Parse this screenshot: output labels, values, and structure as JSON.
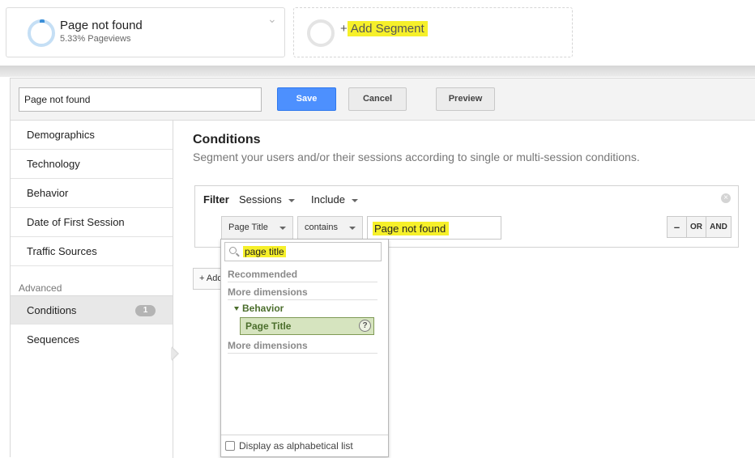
{
  "segments": {
    "active": {
      "title": "Page not found",
      "subtitle": "5.33% Pageviews"
    },
    "add": {
      "plus": "+",
      "label": "Add Segment"
    }
  },
  "editor": {
    "segment_name": "Page not found",
    "buttons": {
      "save": "Save",
      "cancel": "Cancel",
      "preview": "Preview"
    }
  },
  "sidebar": {
    "items": [
      {
        "label": "Demographics"
      },
      {
        "label": "Technology"
      },
      {
        "label": "Behavior"
      },
      {
        "label": "Date of First Session"
      },
      {
        "label": "Traffic Sources"
      }
    ],
    "advanced_label": "Advanced",
    "advanced_items": [
      {
        "label": "Conditions",
        "badge": "1",
        "active": true
      },
      {
        "label": "Sequences"
      }
    ]
  },
  "conditions": {
    "title": "Conditions",
    "description": "Segment your users and/or their sessions according to single or multi-session conditions.",
    "filter": {
      "label": "Filter",
      "scope": "Sessions",
      "mode": "Include",
      "dimension": "Page Title",
      "operator": "contains",
      "value": "Page not found",
      "buttons": {
        "minus": "–",
        "or": "OR",
        "and": "AND"
      }
    },
    "add_button": "+ Add"
  },
  "dimension_picker": {
    "search_value": "page title",
    "groups": {
      "recommended": "Recommended",
      "more_dimensions": "More dimensions",
      "category": "Behavior",
      "option": "Page Title",
      "more_dimensions_2": "More dimensions"
    },
    "help_glyph": "?",
    "footer_label": "Display as alphabetical list"
  },
  "colors": {
    "highlight": "#f6f02a",
    "primary_button": "#4d90fe",
    "selected_option": "#d6e4bf",
    "selected_text": "#4b6e2c"
  }
}
